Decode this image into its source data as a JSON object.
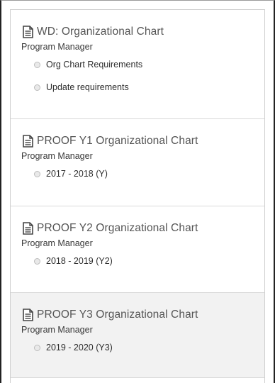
{
  "cards": [
    {
      "title": "WD: Organizational Chart",
      "role": "Program Manager",
      "items": [
        "Org Chart Requirements",
        "Update requirements"
      ],
      "icon": "document-icon"
    },
    {
      "title": "PROOF Y1 Organizational Chart",
      "role": "Program Manager",
      "items": [
        "2017 - 2018 (Y)"
      ],
      "icon": "document-icon"
    },
    {
      "title": "PROOF Y2 Organizational Chart",
      "role": "Program Manager",
      "items": [
        "2018 - 2019 (Y2)"
      ],
      "icon": "document-icon"
    },
    {
      "title": "PROOF Y3 Organizational Chart",
      "role": "Program Manager",
      "items": [
        "2019 - 2020 (Y3)"
      ],
      "icon": "document-icon"
    }
  ],
  "colors": {
    "title": "#555555",
    "text": "#2e2e2e",
    "border": "#d9d9d9",
    "hover_background": "#f2f2f2"
  }
}
